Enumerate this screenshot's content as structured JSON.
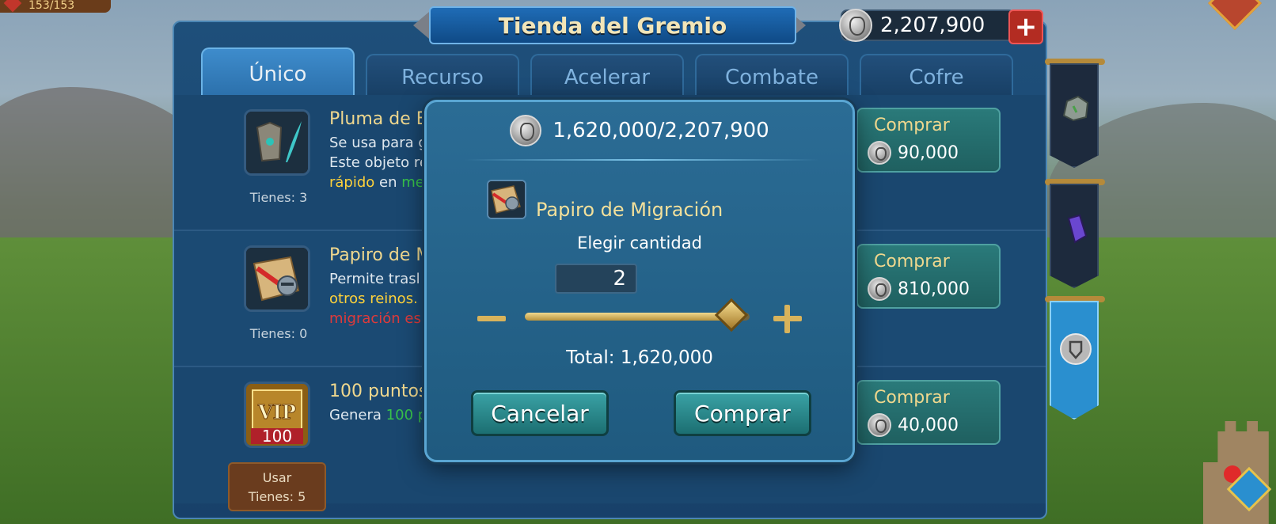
{
  "topbar": {
    "stat": "153/153"
  },
  "header": {
    "title": "Tienda del Gremio"
  },
  "currency": {
    "amount": "2,207,900",
    "add_label": "+"
  },
  "tabs": [
    {
      "label": "Único",
      "active": true
    },
    {
      "label": "Recurso",
      "active": false
    },
    {
      "label": "Acelerar",
      "active": false
    },
    {
      "label": "Combate",
      "active": false
    },
    {
      "label": "Cofre",
      "active": false
    }
  ],
  "items": [
    {
      "name": "Pluma de E",
      "desc1": "Se usa para g",
      "desc2": "Este objeto re",
      "desc3a": "rápido",
      "desc3b": " en ",
      "desc3c": "me",
      "have": "Tienes: 3",
      "buy_label": "Comprar",
      "price": "90,000"
    },
    {
      "name": "Papiro de M",
      "desc1": "Permite trasl",
      "desc2": "otros reinos.",
      "desc3": "migración es",
      "have": "Tienes: 0",
      "buy_label": "Comprar",
      "price": "810,000"
    },
    {
      "name": "100 puntos",
      "desc1a": "Genera ",
      "desc1b": "100 p",
      "icon_text": "100",
      "icon_vip": "VIP",
      "use_label": "Usar",
      "have": "Tienes: 5",
      "buy_label": "Comprar",
      "price": "40,000"
    }
  ],
  "modal": {
    "balance": "1,620,000/2,207,900",
    "item_name": "Papiro de Migración",
    "qty_label": "Elegir cantidad",
    "quantity": "2",
    "slider_fraction": 0.92,
    "total": "Total: 1,620,000",
    "cancel_label": "Cancelar",
    "buy_label": "Comprar"
  },
  "colors": {
    "accent_gold": "#f0d88e",
    "panel_blue": "#1e4f7a",
    "button_teal": "#2a7a7a",
    "active_tab": "#3e8ccc"
  },
  "icons": [
    "coin-icon",
    "plus-icon",
    "minus-icon",
    "feather-armor-icon",
    "scroll-icon",
    "vip-icon",
    "rock-icon",
    "crystal-icon",
    "shield-icon"
  ]
}
